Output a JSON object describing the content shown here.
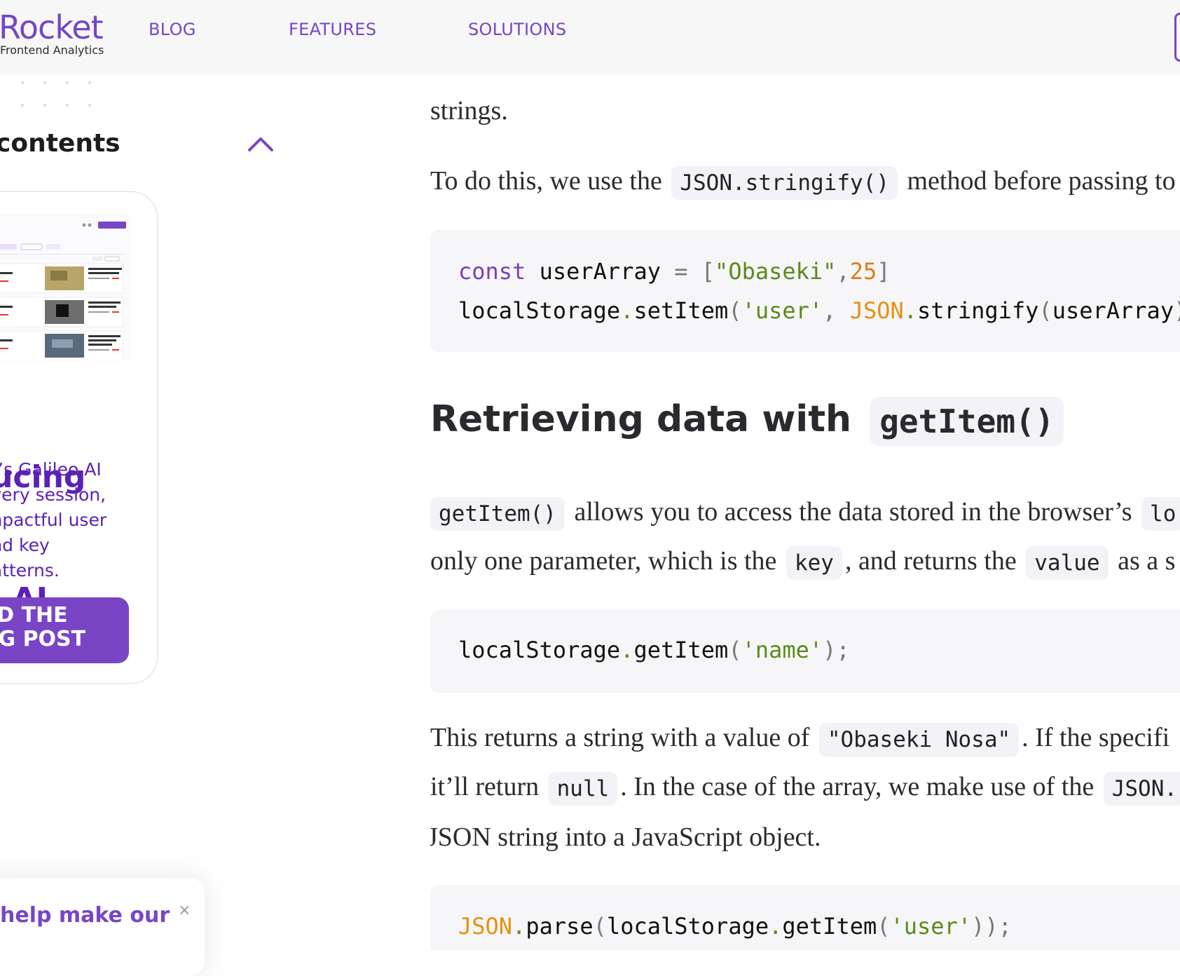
{
  "nav": {
    "logo_word": "Rocket",
    "logo_tagline": "Frontend Analytics",
    "links": [
      "BLOG",
      "FEATURES",
      "SOLUTIONS"
    ]
  },
  "sidebar": {
    "toc_title": "contents",
    "promo": {
      "heading_lines": [
        "lucing",
        "o AI"
      ],
      "body_lines": [
        "et’s Galileo AI",
        "every session,",
        "impactful user",
        "and key",
        "patterns."
      ],
      "button_lines": [
        "AD THE",
        "OG POST"
      ]
    }
  },
  "feedback": {
    "text": "help make our",
    "close": "×"
  },
  "article": {
    "p_strings": "strings.",
    "p_todo_before": "To do this, we use the",
    "p_todo_code": "JSON.stringify()",
    "p_todo_after": "method before passing to",
    "code1": {
      "line1": {
        "kw": "const",
        "name": " userArray ",
        "eq": "=",
        "sp": " ",
        "lb": "[",
        "str": "\"Obaseki\"",
        "comma": ",",
        "num": "25",
        "rb": "]"
      },
      "line2": {
        "obj": "localStorage",
        "dot": ".",
        "method": "setItem",
        "lp": "(",
        "str": "'user'",
        "comma": ", ",
        "json": "JSON",
        "dot2": ".",
        "method2": "stringify",
        "lp2": "(",
        "arg": "userArray",
        "rp": ")"
      }
    },
    "h2_text": "Retrieving data with",
    "h2_code": "getItem()",
    "p_getitem_code": "getItem()",
    "p_getitem_text": "allows you to access the data stored in the browser’s",
    "p_getitem_code2": "lo",
    "p_param_before": "only one parameter, which is the",
    "p_param_key": "key",
    "p_param_mid": ", and returns the",
    "p_param_value": "value",
    "p_param_after": "as a s",
    "code2": {
      "obj": "localStorage",
      "dot": ".",
      "method": "getItem",
      "lp": "(",
      "str": "'name'",
      "rp": ");"
    },
    "p_returns_before": "This returns a string with a value of",
    "p_returns_code": "\"Obaseki Nosa\"",
    "p_returns_after": ". If the specifi",
    "p_null_before": "it’ll return",
    "p_null_code": "null",
    "p_null_mid": ". In the case of the array, we make use of the",
    "p_null_code2": "JSON.",
    "p_json_line": "JSON string into a JavaScript object.",
    "code3": {
      "json": "JSON",
      "dot": ".",
      "method": "parse",
      "lp": "(",
      "obj": "localStorage",
      "dot2": ".",
      "method2": "getItem",
      "lp2": "(",
      "str": "'user'",
      "rp": "));"
    }
  },
  "colors": {
    "brand": "#7646c7",
    "promo_text": "#5b21b6",
    "code_bg": "#f6f6f8",
    "string": "#5b8a1a",
    "number": "#e07a12",
    "keyword": "#7a3fb8"
  },
  "icons": [
    "chevron-up-icon",
    "close-icon"
  ]
}
